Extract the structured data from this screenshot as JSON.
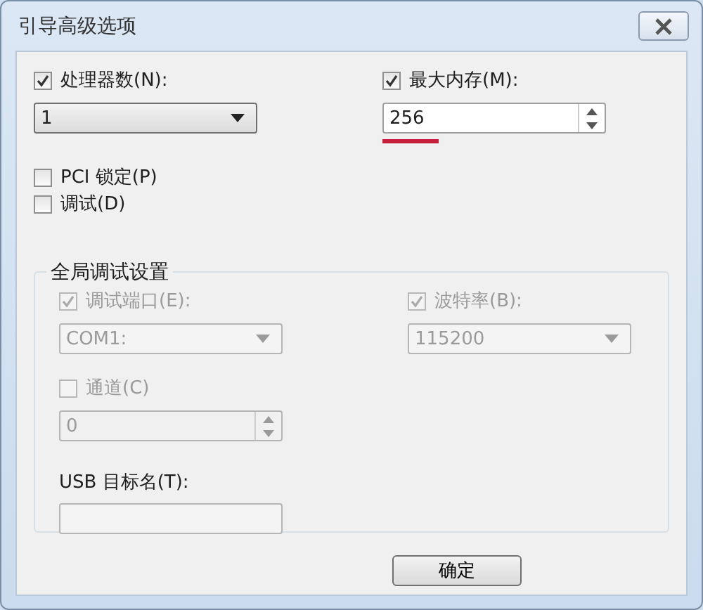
{
  "window": {
    "title": "引导高级选项"
  },
  "processors": {
    "label": "处理器数(N):",
    "checked": true,
    "value": "1"
  },
  "max_memory": {
    "label": "最大内存(M):",
    "checked": true,
    "value": "256"
  },
  "options": [
    {
      "label": "PCI 锁定(P)",
      "checked": false
    },
    {
      "label": "调试(D)",
      "checked": false
    }
  ],
  "global_debug": {
    "title": "全局调试设置",
    "debug_port": {
      "label": "调试端口(E):",
      "checked": true,
      "disabled": true,
      "value": "COM1:"
    },
    "baud_rate": {
      "label": "波特率(B):",
      "checked": true,
      "disabled": true,
      "value": "115200"
    },
    "channel": {
      "label": "通道(C)",
      "checked": false,
      "disabled": true,
      "value": "0"
    },
    "usb_target": {
      "label": "USB 目标名(T):"
    }
  },
  "buttons": [
    "确定"
  ]
}
